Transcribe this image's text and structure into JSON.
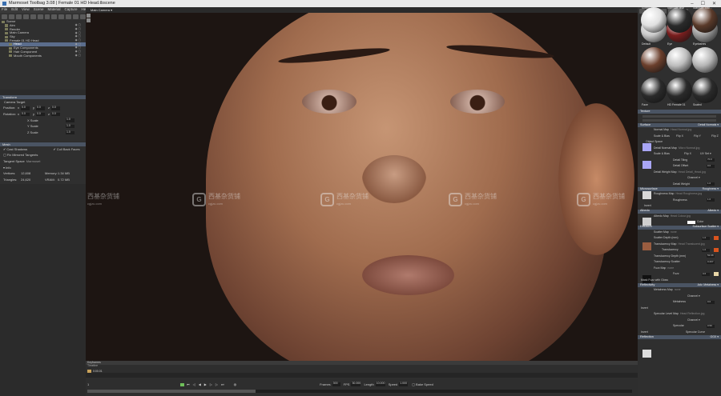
{
  "window": {
    "title": "Marmoset Toolbag 3.08 | Female 01 HD Head.tbscene",
    "controls": [
      "–",
      "☐",
      "✕"
    ]
  },
  "menu": [
    "File",
    "Edit",
    "View",
    "Scene",
    "Material",
    "Capture",
    "Help"
  ],
  "scene_tree": [
    {
      "label": "Scene",
      "depth": 0
    },
    {
      "label": "Aim",
      "depth": 1
    },
    {
      "label": "Render",
      "depth": 1
    },
    {
      "label": "Main Camera",
      "depth": 1
    },
    {
      "label": "Sky",
      "depth": 1
    },
    {
      "label": "Female 01 HD Head",
      "depth": 1
    },
    {
      "label": "Head",
      "depth": 2,
      "selected": true
    },
    {
      "label": "Eye Components",
      "depth": 2
    },
    {
      "label": "Hair Component",
      "depth": 2
    },
    {
      "label": "Mouth Components",
      "depth": 2
    }
  ],
  "transform": {
    "section": "Transform",
    "camera_target": "Camera Target",
    "position_label": "Position:",
    "position": [
      "0.0",
      "0.0",
      "0.0"
    ],
    "rotation_label": "Rotation:",
    "rotation": [
      "0.0",
      "0.0",
      "0.0"
    ],
    "xscale_label": "X Scale",
    "xscale": "1.0",
    "yscale_label": "Y Scale",
    "yscale": "1.0",
    "zscale_label": "Z Scale",
    "zscale": "1.0"
  },
  "mesh": {
    "section": "Mesh",
    "cast_shadows": "Cast Shadows",
    "cull_back": "Cull Back Faces",
    "fix_tangents": "Fix Mirrored Tangents",
    "tangent_space_label": "Tangent Space",
    "tangent_space": "Marmoset",
    "info": "Info",
    "vertices_label": "Vertices:",
    "vertices": "12,608",
    "memory_label": "Memory:",
    "memory": "1.34 MB",
    "triangles_label": "Triangles:",
    "triangles": "24,620",
    "vram_label": "VRAM:",
    "vram": "0.72 MB"
  },
  "viewport": {
    "camera": "Main Camera ▾",
    "watermark_text": "西基杂货铺",
    "watermark_sub": "cgjzu.com",
    "watermark_g": "G"
  },
  "timeline": {
    "label": "Keyframes",
    "sub": "Timeline",
    "time": "0:00.01",
    "frames_label": "Frames",
    "frames": "300",
    "fps_label": "FPS",
    "fps": "30.000",
    "length_label": "Length",
    "length": "10.000",
    "speed_label": "Speed",
    "speed": "1.000",
    "bake_label": "Bake Speed",
    "end": "1"
  },
  "materials": [
    {
      "name": "Default",
      "color": "#c9c9c9"
    },
    {
      "name": "Eye",
      "color": "#7a1e1e"
    },
    {
      "name": "Eyelashes",
      "color": "#9a9a9a"
    },
    {
      "name": "",
      "color": "#6b3f2c"
    },
    {
      "name": "",
      "color": "#bdbdbd"
    },
    {
      "name": "",
      "color": "#b5b5b5"
    },
    {
      "name": "Face",
      "color": "#2a2a2a"
    },
    {
      "name": "HD Female 01",
      "color": "#2a2a2a"
    },
    {
      "name": "Scaled",
      "color": "#2a2a2a"
    },
    {
      "name": "Sclera",
      "color": "#e0e0e0"
    },
    {
      "name": "Standart Tear",
      "color": "#2a2a2a"
    },
    {
      "name": "Standart Tran...",
      "color": "#5a3a2a"
    }
  ],
  "props": {
    "texture": "Texture",
    "surface": "Surface",
    "surface_mode": "Detail Normals ▾",
    "normal_map": "Normal Map",
    "normal_file": "Head Normal.jpg",
    "scale_bias": "Scale & Bias",
    "flip_x": "Flip X",
    "flip_y": "Flip Y",
    "flip_z": "Flip Z",
    "object_space": "Object Space",
    "detail_normal": "Detail Normal Map",
    "detail_file": "Micro Normal.jpg",
    "uv_set": "UV Set ▾",
    "detail_tiling": "Detail Tiling",
    "detail_tiling_v": "70.0",
    "detail_offset": "Detail Offset",
    "detail_offset_v": "0.0",
    "detail_weight_map": "Detail Weight Map",
    "detail_weight_file": "Head Detail_Head.jpg",
    "channel": "Channel ▾",
    "detail_weight": "Detail Weight",
    "detail_weight_v": "1.0",
    "microsurface": "Microsurface",
    "roughness_mode": "Roughness ▾",
    "roughness_map": "Roughness Map",
    "roughness_file": "Head Roughness.jpg",
    "roughness": "Roughness",
    "roughness_v": "1.0",
    "invert": "Invert",
    "albedo": "Albedo",
    "albedo_mode": "Albedo ▾",
    "albedo_map": "Albedo Map",
    "albedo_file": "Head Colour.jpg",
    "color": "Color",
    "diffusion": "Diffusion",
    "diffusion_mode": "Subsurface Scatter ▾",
    "scatter_map": "Scatter Map",
    "scatter_none": "none",
    "scatter_depth": "Scatter Depth (mm)",
    "scatter_depth_v": "1.0",
    "translucency_map": "Translucency Map",
    "translucency_file": "Head Translucent.jpg",
    "translucency": "Translucency",
    "translucency_v": "1.0",
    "transl_depth": "Translucency Depth (mm)",
    "transl_depth_v": "52.98",
    "transl_scatter": "Translucency Scatter",
    "transl_scatter_v": "0.207",
    "fuzz_map": "Fuzz Map",
    "fuzz_none": "none",
    "fuzz": "Fuzz",
    "fuzz_v": "0.6",
    "mask_fuzz": "Mask Fuzz with Gloss",
    "reflectivity": "Reflectivity",
    "reflect_mode": "Adv. Metalness ▾",
    "metalness_map": "Metalness Map",
    "metalness_none": "none",
    "metalness": "Metalness",
    "metalness_v": "0.0",
    "spec_level_map": "Specular Level Map",
    "spec_file": "Head Reflection.jpg",
    "specular": "Specular",
    "specular_v": "0.50",
    "spec_curve": "Specular Curve",
    "reflection": "Reflection",
    "reflection_mode": "GGX ▾"
  },
  "colors": {
    "accent": "#5b6d8c",
    "section": "#4a5463",
    "orange": "#d9541e",
    "pale": "#e8d6a8"
  }
}
